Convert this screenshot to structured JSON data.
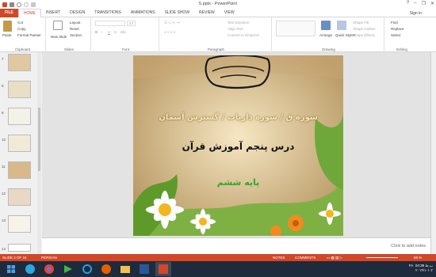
{
  "window": {
    "title": "5.pptx - PowerPoint",
    "sign_in": "Sign in",
    "help": "?",
    "minimize": "–",
    "restore": "❐",
    "close": "✕"
  },
  "tabs": [
    "FILE",
    "HOME",
    "INSERT",
    "DESIGN",
    "TRANSITIONS",
    "ANIMATIONS",
    "SLIDE SHOW",
    "REVIEW",
    "VIEW"
  ],
  "ribbon": {
    "clipboard": {
      "paste": "Paste",
      "cut": "Cut",
      "copy": "Copy",
      "format_painter": "Format Painter",
      "label": "Clipboard"
    },
    "slides": {
      "new_slide": "New Slide",
      "layout": "Layout",
      "reset": "Reset",
      "section": "Section",
      "label": "Slides"
    },
    "font": {
      "size": "24",
      "bold": "B",
      "italic": "I",
      "underline": "U",
      "strike": "S",
      "spacing": "abc",
      "label": "Font"
    },
    "paragraph": {
      "text_direction": "Text Direction",
      "align_text": "Align Text",
      "smartart": "Convert to SmartArt",
      "label": "Paragraph"
    },
    "drawing": {
      "arrange": "Arrange",
      "quick_styles": "Quick Styles",
      "shape_fill": "Shape Fill",
      "shape_outline": "Shape Outline",
      "shape_effects": "Shape Effects",
      "label": "Drawing"
    },
    "editing": {
      "find": "Find",
      "replace": "Replace",
      "select": "Select",
      "label": "Editing"
    }
  },
  "thumbnails": [
    "7",
    "8",
    "9",
    "10",
    "11",
    "12",
    "13",
    "14"
  ],
  "slide": {
    "line1": "سوره ق / سوره ذاریات / گسترش آسمان",
    "line2": "درس پنجم آموزش قرآن",
    "line3": "پایه ششم"
  },
  "notes_placeholder": "Click to add notes",
  "status": {
    "slide": "SLIDE 2 OF 24",
    "language": "PERSIAN",
    "notes": "NOTES",
    "comments": "COMMENTS",
    "zoom": "69 %"
  },
  "tray": {
    "lang": "FA",
    "time": "04:39 ب.ظ",
    "date": "۲۰۱۴/۱۰/۰۲"
  },
  "colors": {
    "accent": "#d24726",
    "taskbar": "#1e2b3c"
  }
}
